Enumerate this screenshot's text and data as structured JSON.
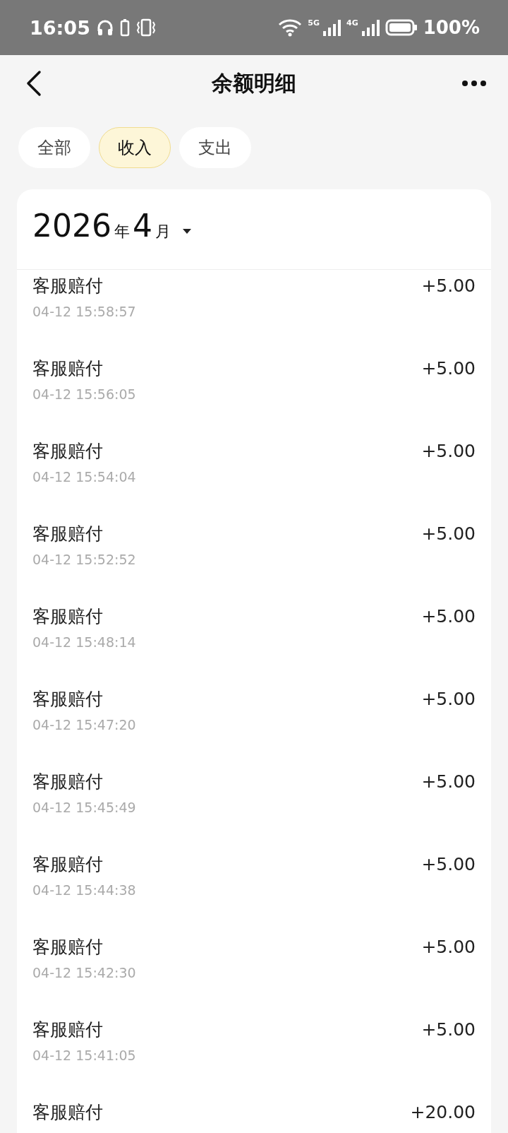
{
  "status_bar": {
    "time": "16:05",
    "network_1": "5G",
    "network_2": "4G",
    "battery": "100%"
  },
  "header": {
    "title": "余额明细"
  },
  "tabs": [
    {
      "label": "全部",
      "selected": false
    },
    {
      "label": "收入",
      "selected": true
    },
    {
      "label": "支出",
      "selected": false
    }
  ],
  "month": {
    "year": "2026",
    "year_unit": "年",
    "month": "4",
    "month_unit": "月"
  },
  "records": [
    {
      "title": "客服赔付",
      "time": "04-12 15:58:57",
      "amount": "+5.00"
    },
    {
      "title": "客服赔付",
      "time": "04-12 15:56:05",
      "amount": "+5.00"
    },
    {
      "title": "客服赔付",
      "time": "04-12 15:54:04",
      "amount": "+5.00"
    },
    {
      "title": "客服赔付",
      "time": "04-12 15:52:52",
      "amount": "+5.00"
    },
    {
      "title": "客服赔付",
      "time": "04-12 15:48:14",
      "amount": "+5.00"
    },
    {
      "title": "客服赔付",
      "time": "04-12 15:47:20",
      "amount": "+5.00"
    },
    {
      "title": "客服赔付",
      "time": "04-12 15:45:49",
      "amount": "+5.00"
    },
    {
      "title": "客服赔付",
      "time": "04-12 15:44:38",
      "amount": "+5.00"
    },
    {
      "title": "客服赔付",
      "time": "04-12 15:42:30",
      "amount": "+5.00"
    },
    {
      "title": "客服赔付",
      "time": "04-12 15:41:05",
      "amount": "+5.00"
    },
    {
      "title": "客服赔付",
      "amount": "+20.00"
    }
  ]
}
